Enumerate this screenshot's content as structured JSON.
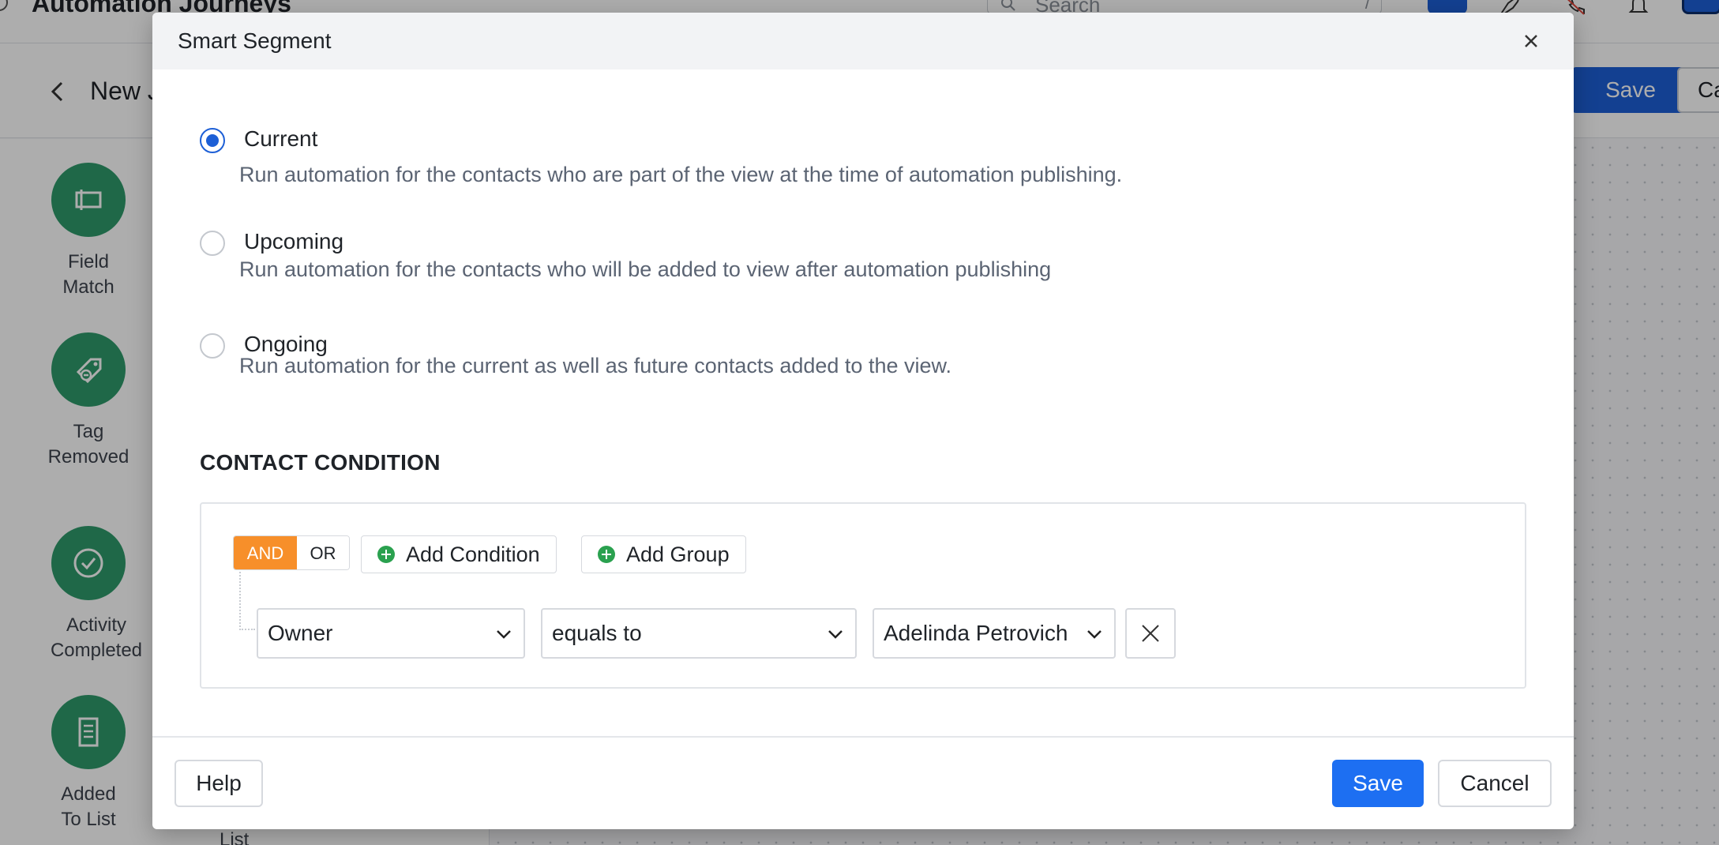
{
  "app": {
    "title": "Automation Journeys",
    "search_placeholder": "Search",
    "search_shortcut": "/",
    "journey_title": "New J",
    "save_label": "Save",
    "cancel_label": "Ca"
  },
  "sidebar": {
    "items": [
      {
        "label_line1": "Field",
        "label_line2": "Match",
        "icon": "field-match-icon"
      },
      {
        "label_line1": "Tag",
        "label_line2": "Removed",
        "icon": "tag-removed-icon"
      },
      {
        "label_line1": "Activity",
        "label_line2": "Completed",
        "icon": "check-circle-icon"
      },
      {
        "label_line1": "Added",
        "label_line2": "To List",
        "icon": "list-icon"
      }
    ],
    "extra_label": "List"
  },
  "modal": {
    "title": "Smart Segment",
    "options": [
      {
        "label": "Current",
        "description": "Run automation for the contacts who are part of the view at the time of automation publishing.",
        "selected": true
      },
      {
        "label": "Upcoming",
        "description": "Run automation for the contacts who will be added to view after automation publishing",
        "selected": false
      },
      {
        "label": "Ongoing",
        "description": "Run automation for the current as well as future contacts added to the view.",
        "selected": false
      }
    ],
    "section_title": "CONTACT CONDITION",
    "logic": {
      "and_label": "AND",
      "or_label": "OR",
      "active": "AND"
    },
    "add_condition_label": "Add Condition",
    "add_group_label": "Add Group",
    "condition": {
      "field": "Owner",
      "operator": "equals to",
      "value": "Adelinda Petrovich"
    },
    "footer": {
      "help_label": "Help",
      "save_label": "Save",
      "cancel_label": "Cancel"
    }
  },
  "colors": {
    "primary": "#1d6ff2",
    "and_active": "#f78f2a",
    "add_icon": "#2aa14f",
    "sidebar_icon_bg": "#2f9a6a"
  }
}
